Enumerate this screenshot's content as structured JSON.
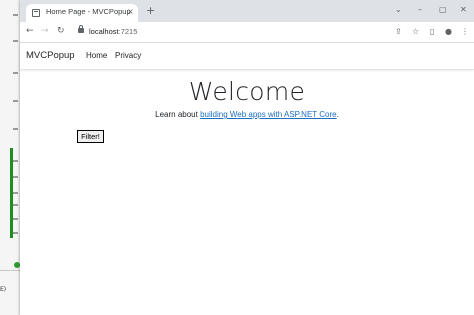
{
  "browser": {
    "tab_title": "Home Page - MVCPopup",
    "tab_close": "×",
    "new_tab": "+",
    "url_host": "localhost",
    "url_port": ":7215",
    "window_controls": {
      "chevron": "⌄",
      "minimize": "–",
      "maximize": "▢",
      "close": "✕"
    },
    "toolbar_icons": {
      "back": "←",
      "forward": "→",
      "reload": "↻",
      "share": "⇪",
      "bookmark": "☆",
      "sidepanel": "▯",
      "profile": "●",
      "menu": "⋮"
    }
  },
  "navbar": {
    "brand": "MVCPopup",
    "links": [
      "Home",
      "Privacy"
    ]
  },
  "main": {
    "heading": "Welcome",
    "lead_prefix": "Learn about ",
    "lead_link": "building Web apps with ASP.NET Core",
    "lead_suffix": ".",
    "filter_button": "Filter!"
  },
  "background": {
    "status_text": "E)"
  },
  "colors": {
    "link": "#1b6ec2",
    "green_bar": "#1e8e1e"
  }
}
